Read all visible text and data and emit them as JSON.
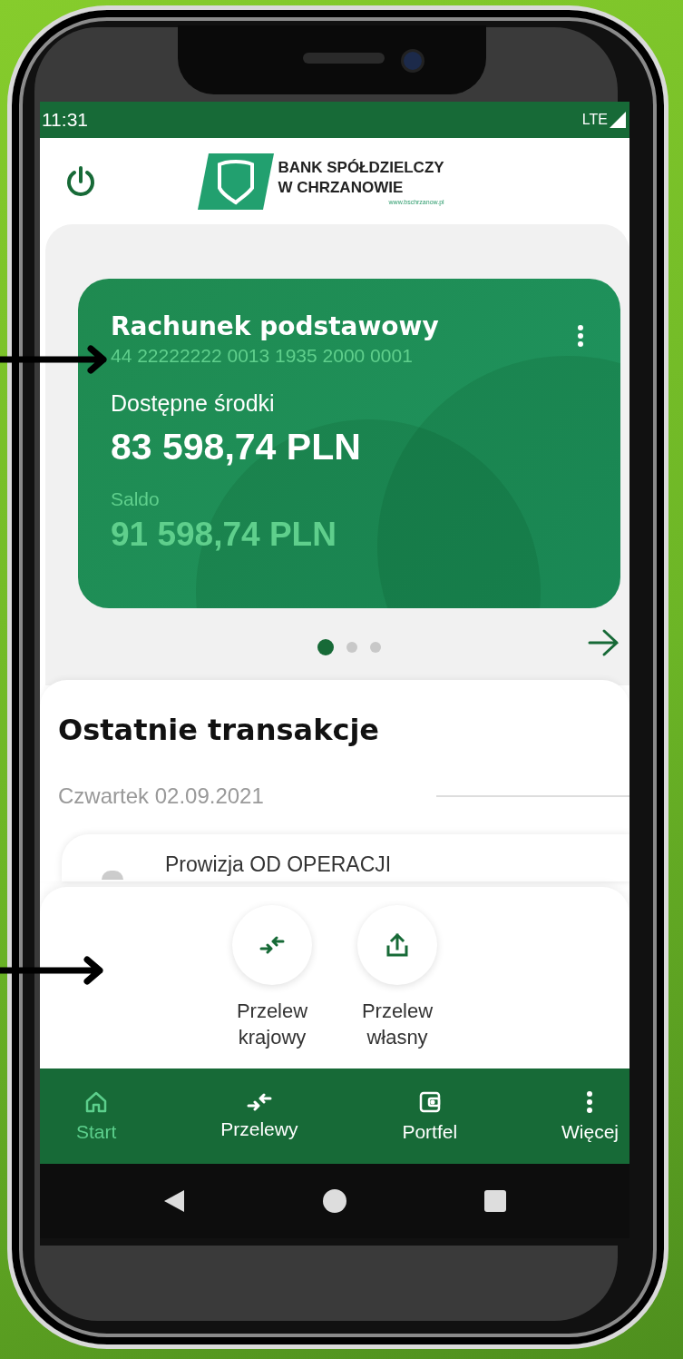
{
  "status_bar": {
    "time": "11:31",
    "network": "LTE"
  },
  "header": {
    "bank_name_line_1": "BANK SPÓŁDZIELCZY",
    "bank_name_line_2": "W CHRZANOWIE",
    "website": "www.bschrzanow.pl"
  },
  "account_card": {
    "title": "Rachunek podstawowy",
    "number": "44 22222222 0013 1935 2000 0001",
    "available_label": "Dostępne środki",
    "available_amount": "83 598,74 PLN",
    "balance_label": "Saldo",
    "balance_amount": "91 598,74 PLN"
  },
  "carousel_dots": [
    {
      "selected": true
    },
    {
      "selected": false
    },
    {
      "selected": false
    }
  ],
  "transactions": {
    "title": "Ostatnie transakcje",
    "date": "Czwartek 02.09.2021",
    "items": [
      {
        "title": "Prowizja OD OPERACJI"
      }
    ]
  },
  "quick_actions": [
    {
      "kind": "domestic",
      "label": "Przelew krajowy"
    },
    {
      "kind": "own",
      "label": "Przelew własny"
    }
  ],
  "bottom_nav": [
    {
      "kind": "home",
      "label": "Start",
      "selected": true
    },
    {
      "kind": "transfers",
      "label": "Przelewy",
      "selected": false
    },
    {
      "kind": "wallet",
      "label": "Portfel",
      "selected": false
    },
    {
      "kind": "more",
      "label": "Więcej",
      "selected": false
    }
  ]
}
